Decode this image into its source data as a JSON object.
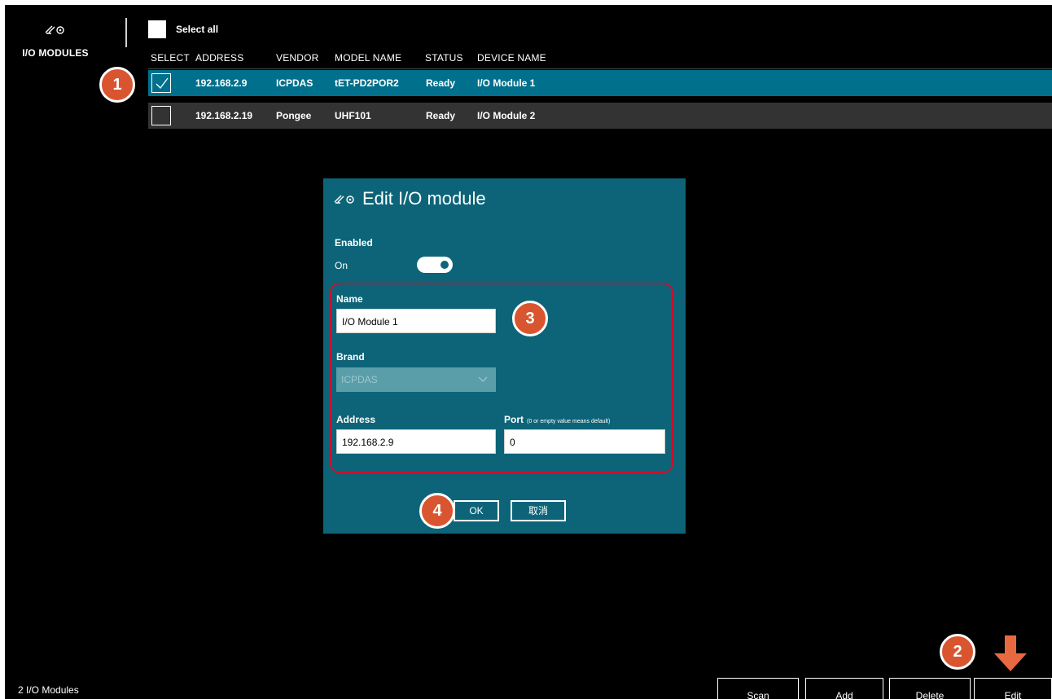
{
  "nav": {
    "icon": "sensor-icon",
    "label": "I/O MODULES"
  },
  "header": {
    "select_all_label": "Select all",
    "columns": [
      "SELECT",
      "ADDRESS",
      "VENDOR",
      "MODEL NAME",
      "STATUS",
      "DEVICE NAME"
    ]
  },
  "rows": [
    {
      "checked": true,
      "address": "192.168.2.9",
      "vendor": "ICPDAS",
      "model": "tET-PD2POR2",
      "status": "Ready",
      "device": "I/O Module 1"
    },
    {
      "checked": false,
      "address": "192.168.2.19",
      "vendor": "Pongee",
      "model": "UHF101",
      "status": "Ready",
      "device": "I/O Module 2"
    }
  ],
  "dialog": {
    "title": "Edit I/O module",
    "enabled_label": "Enabled",
    "toggle_state": "On",
    "name_label": "Name",
    "name_value": "I/O Module 1",
    "brand_label": "Brand",
    "brand_value": "ICPDAS",
    "address_label": "Address",
    "address_value": "192.168.2.9",
    "port_label": "Port",
    "port_hint": "(0 or empty value means default)",
    "port_value": "0",
    "ok_label": "OK",
    "cancel_label": "取消"
  },
  "callouts": [
    "1",
    "2",
    "3",
    "4"
  ],
  "footer": {
    "count_text": "2 I/O Modules",
    "buttons": [
      "Scan",
      "Add",
      "Delete",
      "Edit"
    ]
  },
  "colors": {
    "selected_row": "#00708c",
    "dialog_bg": "#0d6478",
    "callout": "#d9552f",
    "arrow": "#e8693f",
    "highlight_box": "#c8102e"
  }
}
